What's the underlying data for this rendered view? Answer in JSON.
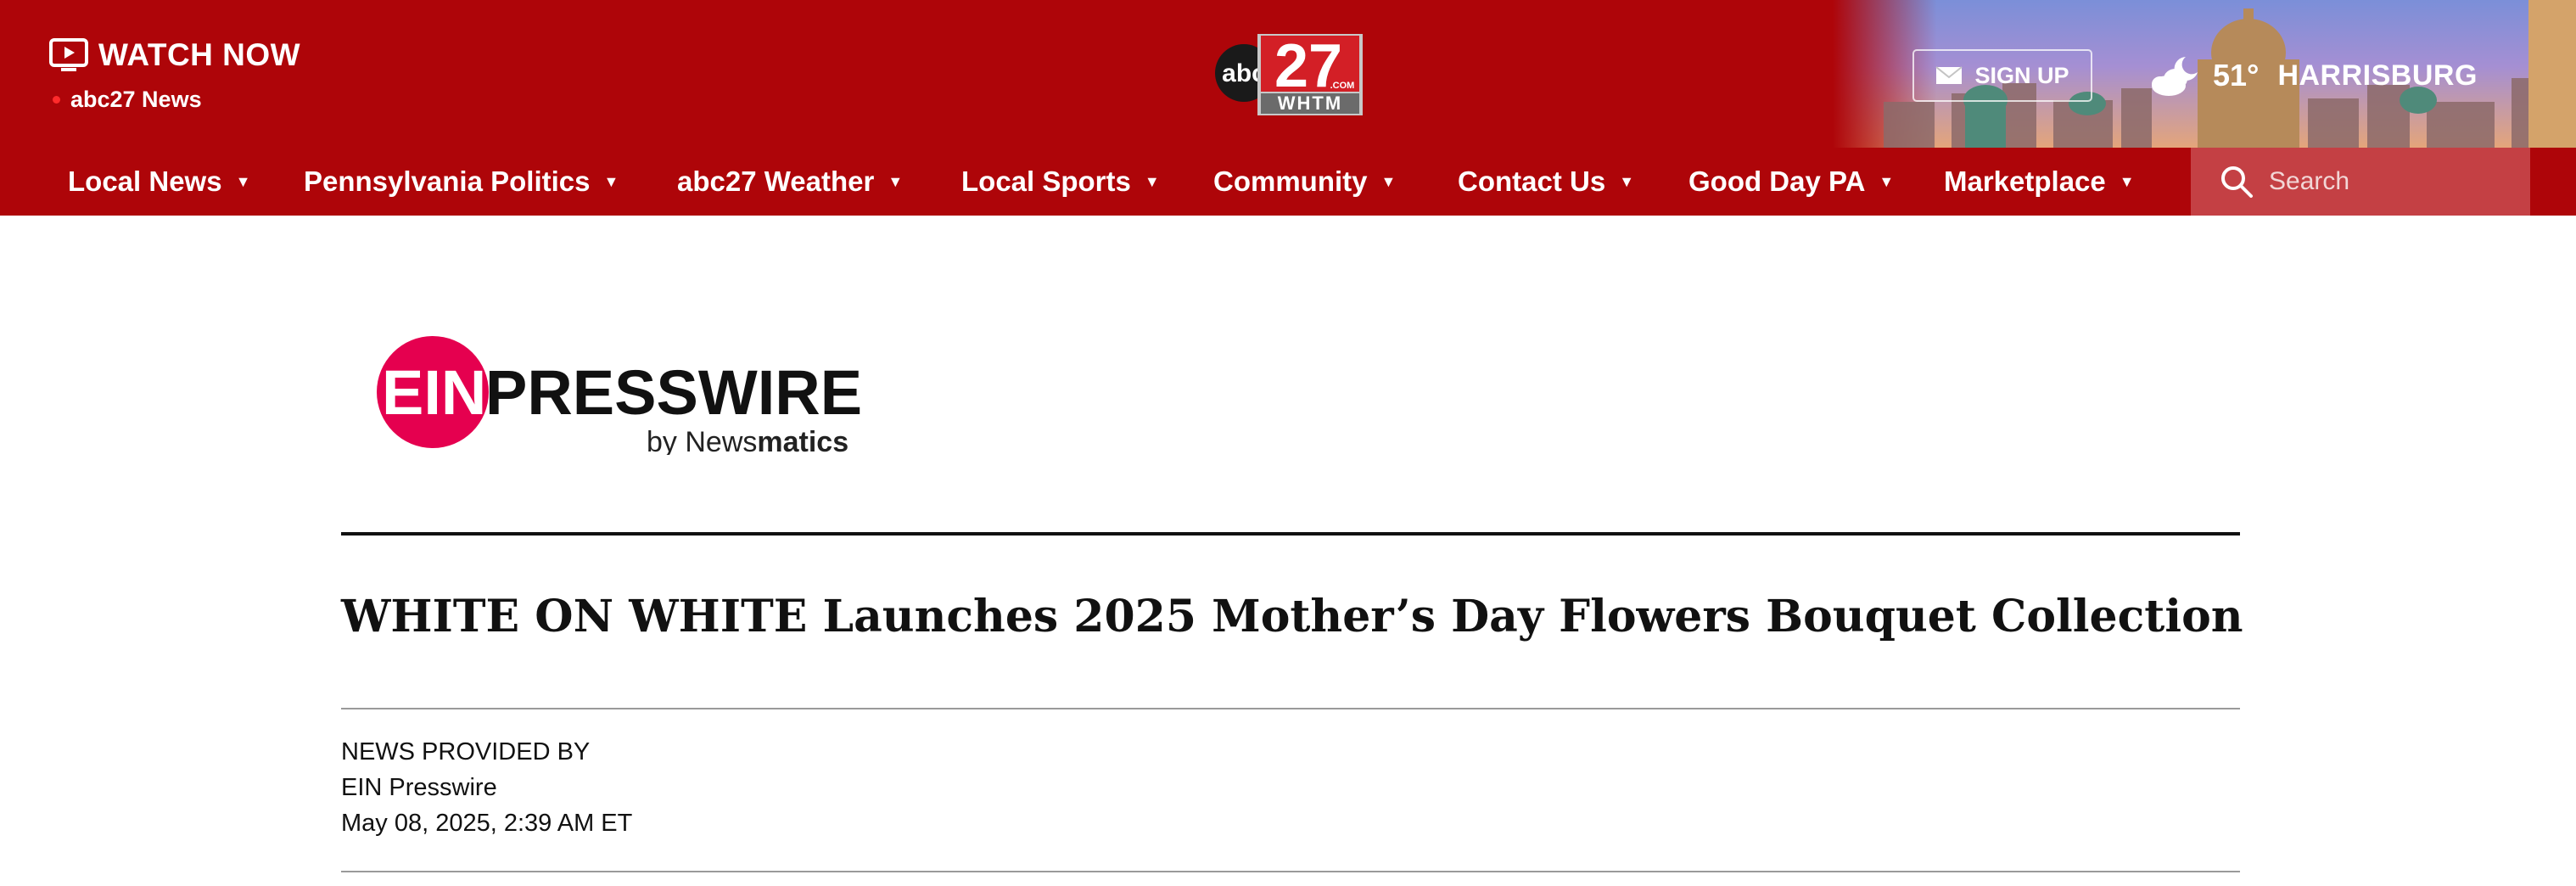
{
  "header": {
    "watch_now": "WATCH NOW",
    "live_label": "abc27 News",
    "logo": {
      "network": "abc",
      "number": "27",
      "com": ".COM",
      "callsign": "WHTM"
    },
    "signup": "SIGN UP",
    "weather": {
      "temp": "51°",
      "city": "HARRISBURG"
    }
  },
  "nav": {
    "items": [
      {
        "label": "Local News"
      },
      {
        "label": "Pennsylvania Politics"
      },
      {
        "label": "abc27 Weather"
      },
      {
        "label": "Local Sports"
      },
      {
        "label": "Community"
      },
      {
        "label": "Contact Us"
      },
      {
        "label": "Good Day PA"
      },
      {
        "label": "Marketplace"
      }
    ],
    "caret": "▼",
    "search_placeholder": "Search"
  },
  "article": {
    "source_logo": {
      "ein": "EIN",
      "presswire": "PRESSWIRE",
      "by": "by News",
      "matics": "matics"
    },
    "headline": "WHITE ON WHITE Launches 2025 Mother’s Day Flowers Bouquet Collection",
    "provided_by_label": "NEWS PROVIDED BY",
    "provider": "EIN Presswire",
    "date": "May 08, 2025, 2:39 AM ET"
  },
  "colors": {
    "brand_red": "#ae0509",
    "search_bg": "#c44044",
    "ein_pink": "#e5004f"
  }
}
